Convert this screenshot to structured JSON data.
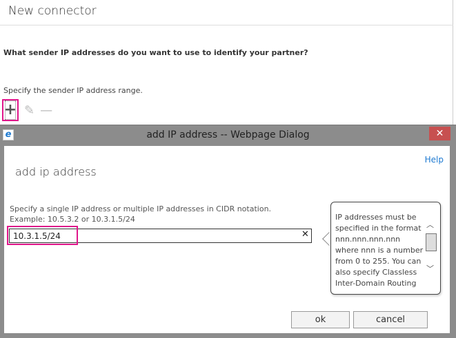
{
  "page": {
    "title": "New connector",
    "question": "What sender IP addresses do you want to use to identify your partner?",
    "instruction": "Specify the sender IP address range.",
    "add_icon": "+",
    "edit_icon": "✎",
    "remove_icon": "—"
  },
  "dialog": {
    "window_title": "add IP address -- Webpage Dialog",
    "close_icon": "✕",
    "help": "Help",
    "heading": "add ip address",
    "instruction_line1": "Specify a single IP address or multiple IP addresses in CIDR notation.",
    "instruction_line2": "Example: 10.5.3.2 or 10.3.1.5/24",
    "input_value": "10.3.1.5/24",
    "clear_icon": "✕",
    "tooltip": "IP addresses must be specified in the format nnn.nnn.nnn.nnn where nnn is a number from 0 to 255. You can also specify Classless Inter-Domain Routing (CIDR)",
    "ok": "ok",
    "cancel": "cancel"
  },
  "colors": {
    "highlight": "#e0168b",
    "close": "#c75050",
    "link": "#1e7ad1"
  }
}
